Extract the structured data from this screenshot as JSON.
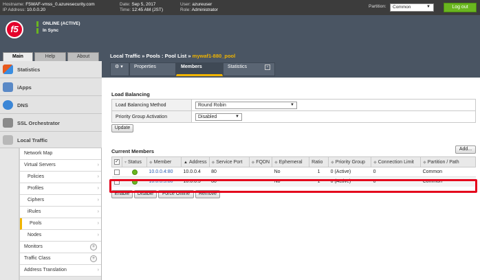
{
  "topbar": {
    "hostname_label": "Hostname:",
    "hostname": "F5WAF-vmss_0.azuresecurity.com",
    "ip_label": "IP Address:",
    "ip": "10.0.0.20",
    "date_label": "Date:",
    "date": "Sep 5, 2017",
    "time_label": "Time:",
    "time": "12:45 AM (JST)",
    "user_label": "User:",
    "user": "azureuser",
    "role_label": "Role:",
    "role": "Administrator",
    "partition_label": "Partition:",
    "partition_value": "Common",
    "logout_label": "Log out"
  },
  "header": {
    "logo_text": "f5",
    "status_line1": "ONLINE (ACTIVE)",
    "status_line2": "In Sync"
  },
  "left_tabs": [
    "Main",
    "Help",
    "About"
  ],
  "sidebar": {
    "sections": {
      "statistics": "Statistics",
      "iapps": "iApps",
      "dns": "DNS",
      "ssl": "SSL Orchestrator",
      "local_traffic": "Local Traffic"
    },
    "items": {
      "network_map": "Network Map",
      "virtual_servers": "Virtual Servers",
      "policies": "Policies",
      "profiles": "Profiles",
      "ciphers": "Ciphers",
      "irules": "iRules",
      "pools": "Pools",
      "nodes": "Nodes",
      "monitors": "Monitors",
      "traffic_class": "Traffic Class",
      "address_translation": "Address Translation"
    }
  },
  "breadcrumb": {
    "part1": "Local Traffic",
    "sep": "»",
    "part2": "Pools : Pool List",
    "current": "mywaf1-880_pool"
  },
  "right_tabs": {
    "properties": "Properties",
    "members": "Members",
    "statistics": "Statistics"
  },
  "load_balancing": {
    "title": "Load Balancing",
    "method_label": "Load Balancing Method",
    "method_value": "Round Robin",
    "priority_label": "Priority Group Activation",
    "priority_value": "Disabled",
    "update_label": "Update"
  },
  "members": {
    "title": "Current Members",
    "add_label": "Add...",
    "columns": {
      "status": "Status",
      "member": "Member",
      "address": "Address",
      "service_port": "Service Port",
      "fqdn": "FQDN",
      "ephemeral": "Ephemeral",
      "ratio": "Ratio",
      "priority_group": "Priority Group",
      "connection_limit": "Connection Limit",
      "partition_path": "Partition / Path"
    },
    "rows": [
      {
        "member": "10.0.0.4:80",
        "address": "10.0.0.4",
        "port": "80",
        "fqdn": "",
        "ephemeral": "No",
        "ratio": "1",
        "priority": "0 (Active)",
        "limit": "0",
        "partition": "Common"
      },
      {
        "member": "10.0.0.5:80",
        "address": "10.0.0.5",
        "port": "80",
        "fqdn": "",
        "ephemeral": "No",
        "ratio": "1",
        "priority": "0 (Active)",
        "limit": "0",
        "partition": "Common"
      }
    ],
    "buttons": {
      "enable": "Enable",
      "disable": "Disable",
      "force_offline": "Force Offline",
      "remove": "Remove"
    }
  },
  "colors": {
    "accent": "#f0b400",
    "brand": "#e4002b",
    "status_ok": "#6ab61f",
    "highlight": "#e4001b"
  }
}
